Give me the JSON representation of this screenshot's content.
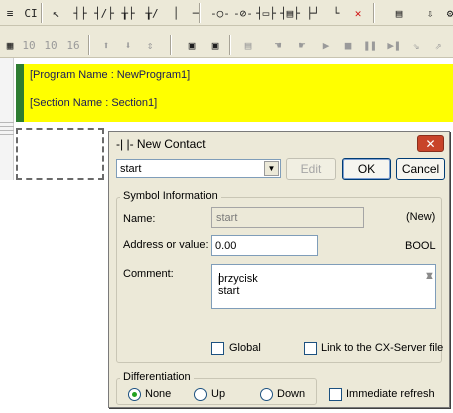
{
  "toolbar_top": {
    "items": [
      {
        "icon": "symbol-table-icon",
        "glyph": "≡"
      },
      {
        "icon": "cross-reference-icon",
        "glyph": "CI"
      },
      {
        "icon": "select-pointer-icon",
        "glyph": "↖"
      },
      {
        "icon": "contact-no-icon",
        "glyph": "┤├"
      },
      {
        "icon": "contact-nc-icon",
        "glyph": "┤/├"
      },
      {
        "icon": "contact-or-no-icon",
        "glyph": "╁├"
      },
      {
        "icon": "contact-or-nc-icon",
        "glyph": "╁/"
      },
      {
        "icon": "vertical-line-icon",
        "glyph": "│"
      },
      {
        "icon": "horizontal-line-icon",
        "glyph": "─"
      },
      {
        "icon": "coil-no-icon",
        "glyph": "-○-"
      },
      {
        "icon": "coil-nc-icon",
        "glyph": "-⊘-"
      },
      {
        "icon": "instruction-icon",
        "glyph": "┤▭├"
      },
      {
        "icon": "instruction-block-icon",
        "glyph": "┤▤├"
      },
      {
        "icon": "connection-icon",
        "glyph": "├┘"
      },
      {
        "icon": "line-connect-icon",
        "glyph": "└"
      },
      {
        "icon": "delete-line-icon",
        "glyph": "✕"
      },
      {
        "icon": "online-edit-icon",
        "glyph": "▤"
      },
      {
        "icon": "transfer-icon",
        "glyph": "⇩"
      },
      {
        "icon": "compile-icon",
        "glyph": "⚙"
      }
    ]
  },
  "toolbar_bottom": {
    "items": [
      {
        "icon": "view-toggle-icon",
        "glyph": "▦"
      },
      {
        "icon": "address-10-icon",
        "glyph": "10"
      },
      {
        "icon": "address-10b-icon",
        "glyph": "10"
      },
      {
        "icon": "address-16-icon",
        "glyph": "16"
      },
      {
        "icon": "rung-up-icon",
        "glyph": "⬆"
      },
      {
        "icon": "rung-down-icon",
        "glyph": "⬇"
      },
      {
        "icon": "rung-move-icon",
        "glyph": "⇕"
      },
      {
        "icon": "monitor-icon",
        "glyph": "▣"
      },
      {
        "icon": "monitor-alt-icon",
        "glyph": "▣"
      },
      {
        "icon": "differential-monitor-icon",
        "glyph": "▤"
      },
      {
        "icon": "hand-force-on-icon",
        "glyph": "☚"
      },
      {
        "icon": "hand-force-off-icon",
        "glyph": "☛"
      },
      {
        "icon": "run-icon",
        "glyph": "▶"
      },
      {
        "icon": "stop-icon",
        "glyph": "■"
      },
      {
        "icon": "pause-icon",
        "glyph": "❚❚"
      },
      {
        "icon": "step-icon",
        "glyph": "▶❚"
      },
      {
        "icon": "step-in-icon",
        "glyph": "⇘"
      },
      {
        "icon": "step-out-icon",
        "glyph": "⇗"
      }
    ]
  },
  "section_header": {
    "program_line": "[Program Name : NewProgram1]",
    "section_line": "[Section Name : Section1]"
  },
  "dialog": {
    "title": "-|   |- New Contact",
    "close_glyph": "✕",
    "name_combo_value": "start",
    "combo_arrow_glyph": "▼",
    "edit_button": "Edit",
    "ok_button": "OK",
    "cancel_button": "Cancel",
    "symbol_info_legend": "Symbol Information",
    "name_label": "Name:",
    "name_value": "start",
    "name_status": "(New)",
    "address_label": "Address or value:",
    "address_value": "0.00",
    "data_type": "BOOL",
    "comment_label": "Comment:",
    "comment_value": "przycisk start",
    "global_label": "Global",
    "link_label": "Link to the CX-Server file",
    "differentiation_legend": "Differentiation",
    "diff_options": [
      "None",
      "Up",
      "Down"
    ],
    "diff_selected": "None",
    "immediate_refresh_label": "Immediate refresh"
  },
  "colors": {
    "section_header_bg": "#ffff00",
    "section_marker": "#2e7d32",
    "dialog_bg": "#ece9d8",
    "close_button": "#c8442a"
  }
}
